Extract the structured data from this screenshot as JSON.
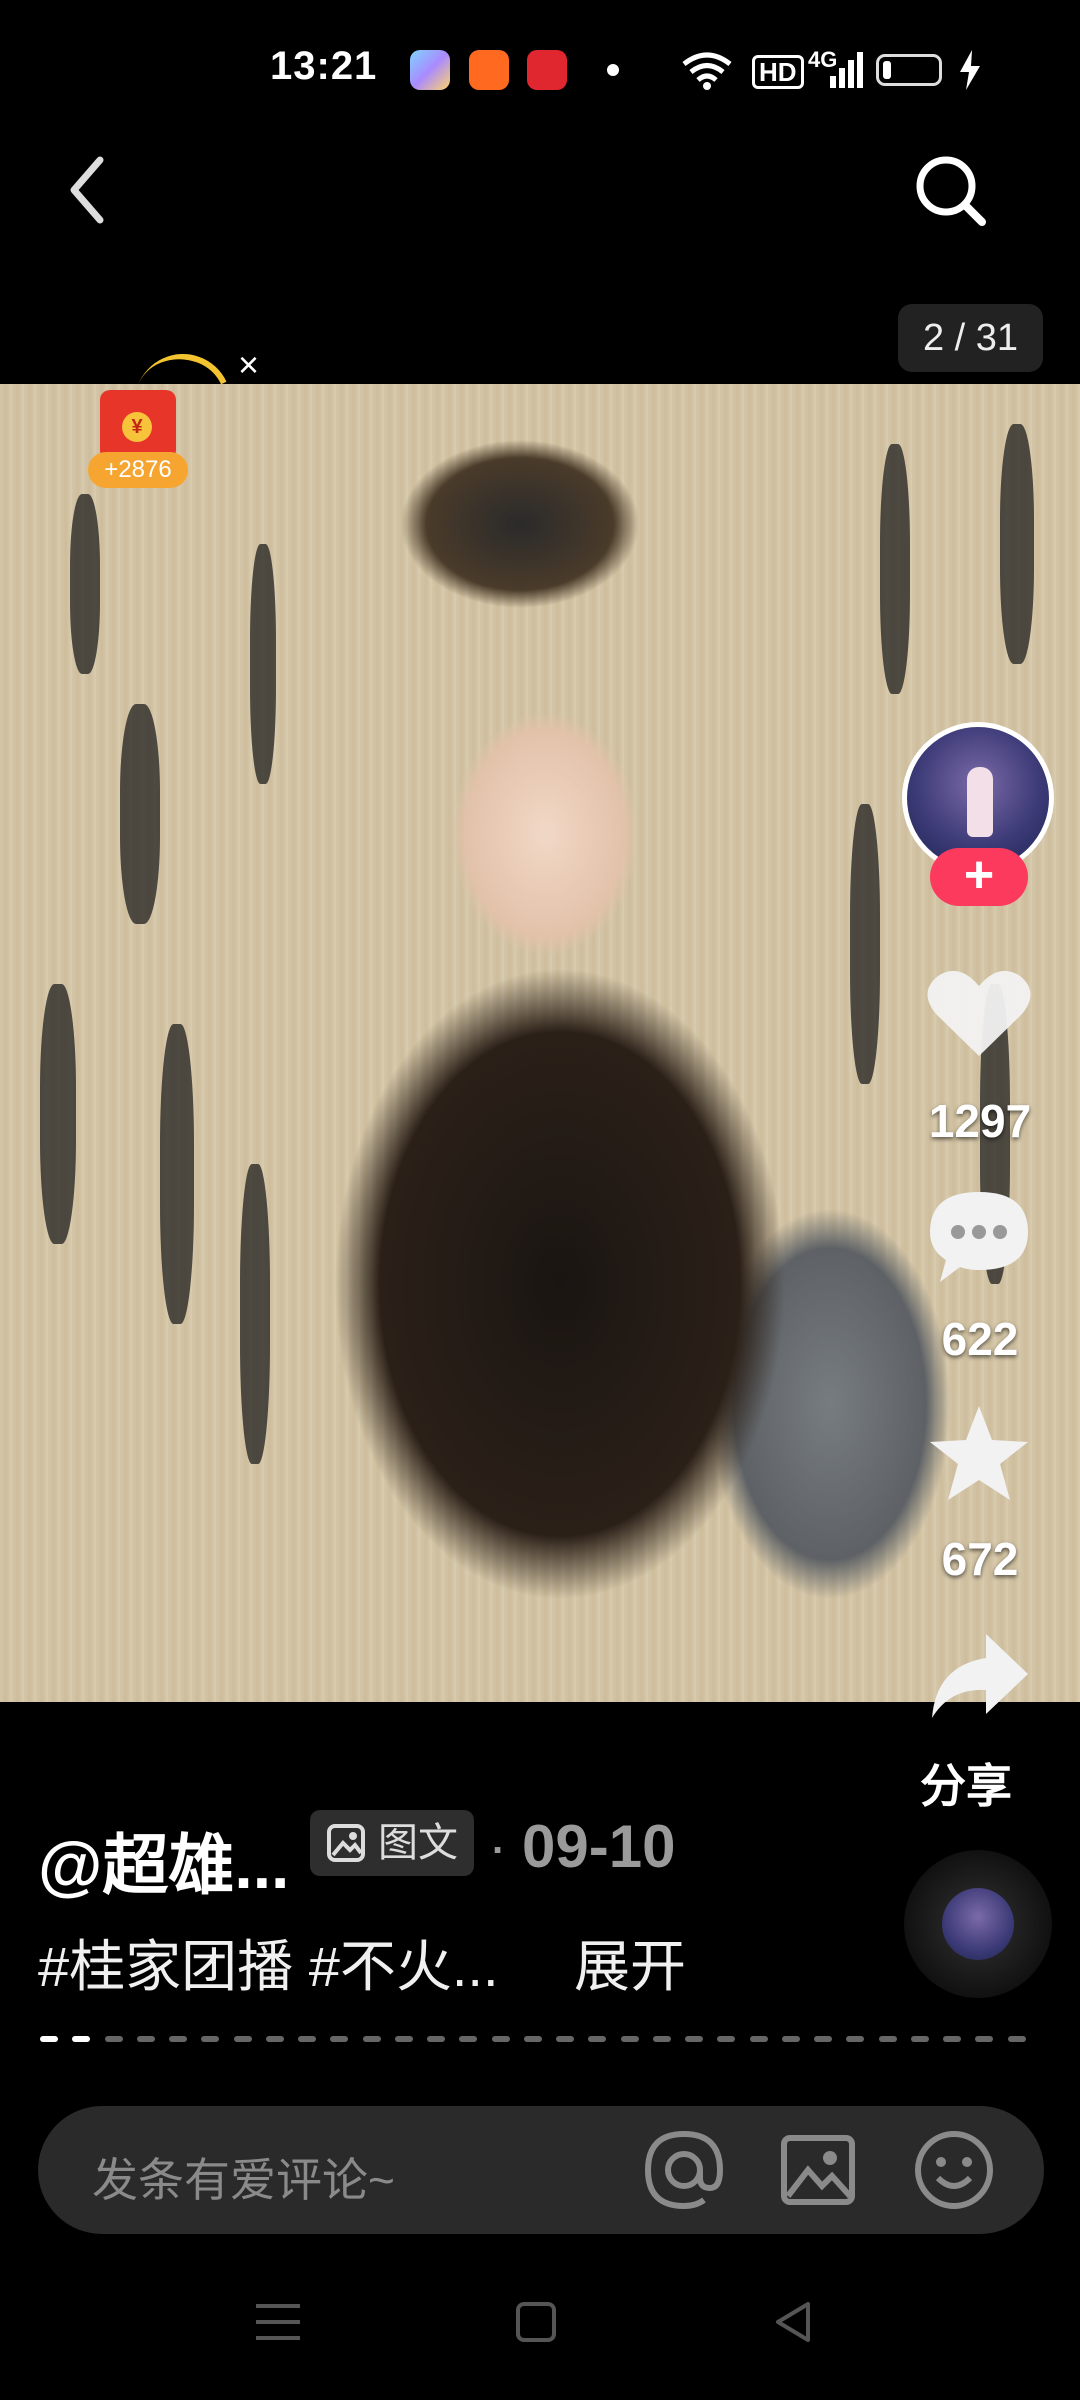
{
  "status_bar": {
    "time": "13:21",
    "hd_label": "HD",
    "network_label": "4G",
    "app_icons": [
      "gallery-app-icon",
      "orange-app-icon",
      "red-app-icon"
    ]
  },
  "top_bar": {
    "back_icon": "chevron-left-icon",
    "search_icon": "search-icon",
    "page_counter": "2 / 31"
  },
  "red_packet": {
    "amount": "+2876",
    "coin_symbol": "¥",
    "close_symbol": "×"
  },
  "actions": {
    "follow_symbol": "+",
    "likes": "1297",
    "comments": "622",
    "favorites": "672",
    "share_label": "分享"
  },
  "post": {
    "author": "@超雄...",
    "type_label": "图文",
    "date_separator": "·",
    "date": "09-10",
    "tags": "#桂家团播 #不火...",
    "expand_label": "展开",
    "slide_count": 31,
    "current_slide": 2
  },
  "comment_bar": {
    "placeholder": "发条有爱评论~",
    "icons": [
      "at-icon",
      "image-icon",
      "emoji-icon"
    ]
  },
  "colors": {
    "follow_pink": "#fb3a5e",
    "red_packet": "#e8352a",
    "red_packet_amount": "#f7a531",
    "date_gray": "#9a9a9a"
  }
}
